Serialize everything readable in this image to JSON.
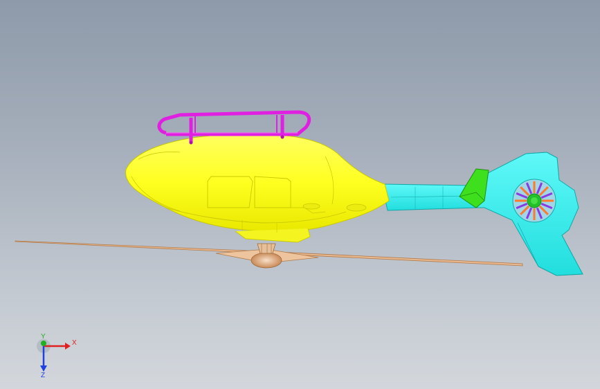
{
  "view": {
    "background_top": "#8e9aaa",
    "background_bottom": "#d3d7dc"
  },
  "model": {
    "fuselage_color": "#ffff26",
    "tail_color": "#33f0f0",
    "rail_color": "#e020e0",
    "fin_color": "#3ee01e",
    "rotor_color": "#e8b78e",
    "fan_hub_color": "#22c12a"
  },
  "triad": {
    "x_label": "X",
    "y_label": "Y",
    "z_label": "Z",
    "x_color": "#e02020",
    "y_color": "#20b020",
    "z_color": "#2040e0"
  }
}
